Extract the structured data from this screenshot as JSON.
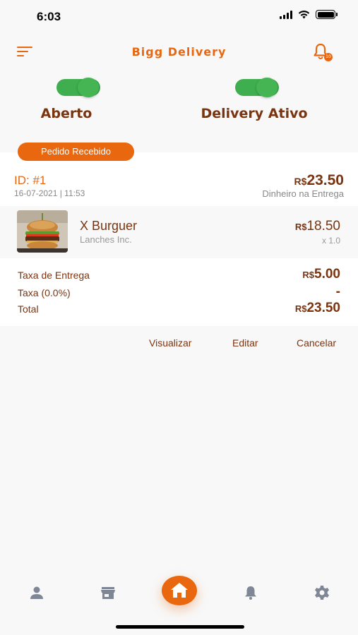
{
  "status_bar": {
    "time": "6:03"
  },
  "header": {
    "title": "Bigg Delivery",
    "notification_count": "10"
  },
  "toggles": [
    {
      "label": "Aberto",
      "on": true
    },
    {
      "label": "Delivery Ativo",
      "on": true
    }
  ],
  "order": {
    "status": "Pedido Recebido",
    "id": "ID: #1",
    "datetime": "16-07-2021 | 11:53",
    "total_currency": "R$",
    "total_amount": "23.50",
    "payment_method": "Dinheiro na Entrega",
    "item": {
      "name": "X Burguer",
      "store": "Lanches Inc.",
      "price_currency": "R$",
      "price_amount": "18.50",
      "quantity": "x 1.0"
    },
    "fees": [
      {
        "label": "Taxa de Entrega",
        "currency": "R$",
        "amount": "5.00"
      },
      {
        "label": "Taxa (0.0%)",
        "currency": "",
        "amount": "-"
      },
      {
        "label": "Total",
        "currency": "R$",
        "amount": "23.50"
      }
    ],
    "actions": {
      "view": "Visualizar",
      "edit": "Editar",
      "cancel": "Cancelar"
    }
  },
  "bottom_nav": {
    "items": [
      "profile-icon",
      "store-icon",
      "home-icon",
      "bell-icon",
      "gear-icon"
    ],
    "active": "home-icon"
  },
  "colors": {
    "accent": "#e8670f",
    "toggle_on": "#45b453",
    "text_dark": "#7a3410"
  }
}
